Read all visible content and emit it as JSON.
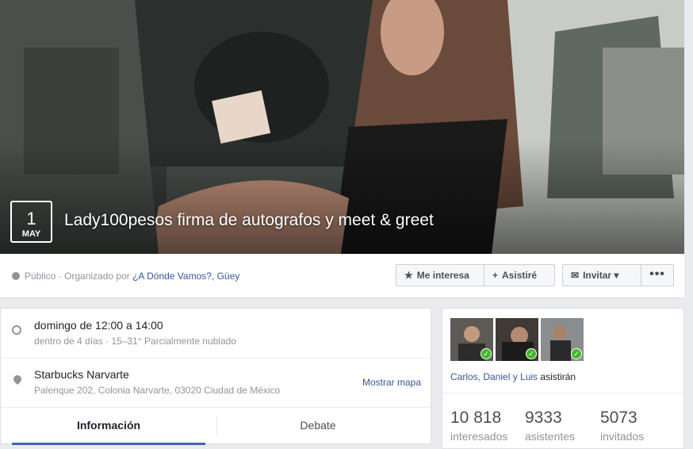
{
  "event": {
    "day": "1",
    "month": "MAY",
    "title": "Lady100pesos firma de autografos y meet & greet"
  },
  "info_bar": {
    "privacy": "Público",
    "organized_by_prefix": "· Organizado por",
    "organizers": "¿A Dónde Vamos?, Güey",
    "buttons": {
      "interest": "Me interesa",
      "attended": "Asistiré",
      "invite": "Invitar",
      "more": "•••"
    }
  },
  "details": {
    "time_main": "domingo de 12:00 a 14:00",
    "time_sub": "dentro de 4 días · 15–31° Parcialmente nublado",
    "location_name": "Starbucks Narvarte",
    "location_address": "Palenque 202, Colonia Narvarte, 03020 Ciudad de México",
    "map_link": "Mostrar mapa",
    "tabs": [
      "Información",
      "Debate"
    ]
  },
  "attendees": {
    "names": "Carlos, Daniel y Luis",
    "verb": "asistirán",
    "stats": [
      {
        "number": "10 818",
        "label": "interesados"
      },
      {
        "number": "9333",
        "label": "asistentes"
      },
      {
        "number": "5073",
        "label": "invitados"
      }
    ]
  },
  "colors": {
    "link": "#365899",
    "accent_tab": "#4267b2",
    "going_check": "#42b72a"
  }
}
